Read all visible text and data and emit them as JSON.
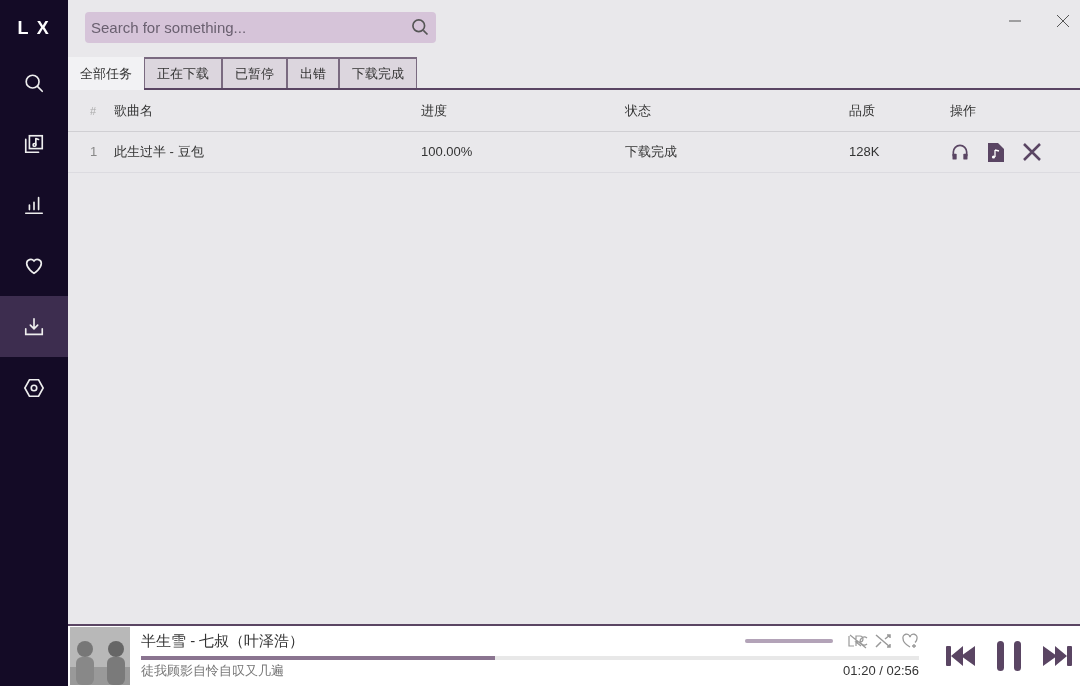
{
  "logo": "L X",
  "sidebar": {
    "items": [
      {
        "kind": "search",
        "selected": false
      },
      {
        "kind": "songlist",
        "selected": false
      },
      {
        "kind": "chart",
        "selected": false
      },
      {
        "kind": "heart",
        "selected": false
      },
      {
        "kind": "download",
        "selected": true
      },
      {
        "kind": "settings",
        "selected": false
      }
    ]
  },
  "search": {
    "placeholder": "Search for something..."
  },
  "tabs": [
    {
      "label": "全部任务",
      "selected": true
    },
    {
      "label": "正在下载",
      "selected": false
    },
    {
      "label": "已暂停",
      "selected": false
    },
    {
      "label": "出错",
      "selected": false
    },
    {
      "label": "下载完成",
      "selected": false
    }
  ],
  "table": {
    "columns": [
      "#",
      "歌曲名",
      "进度",
      "状态",
      "品质",
      "操作"
    ],
    "rows": [
      {
        "index": "1",
        "name": "此生过半 - 豆包",
        "progress": "100.00%",
        "status": "下载完成",
        "quality": "128K"
      }
    ]
  },
  "player": {
    "title": "半生雪 - 七叔（叶泽浩）",
    "lyric": "徒我顾影自怜自叹又几遍",
    "time": "01:20 / 02:56",
    "progress": {
      "level": 0.455
    },
    "volume": {
      "level": 1
    }
  }
}
